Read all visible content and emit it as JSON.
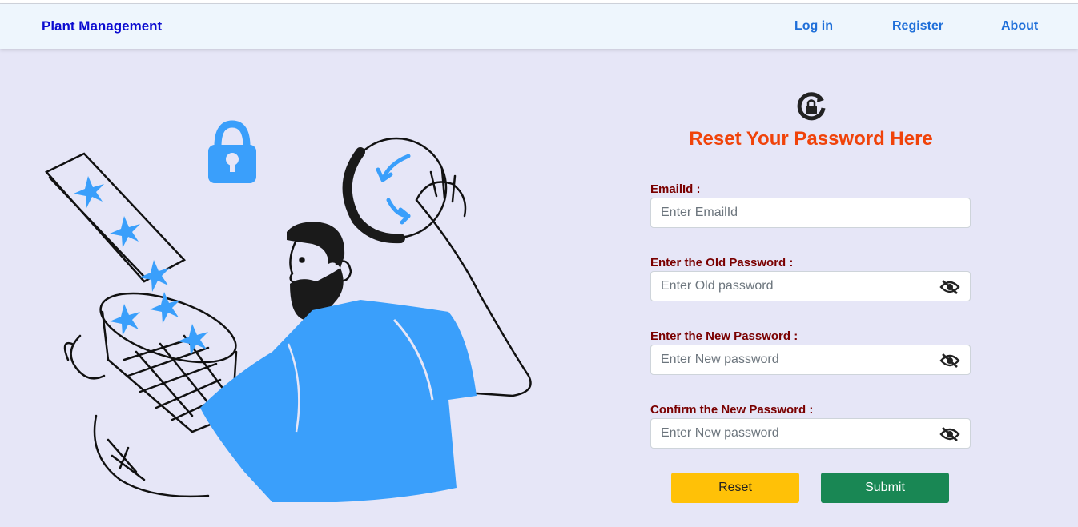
{
  "navbar": {
    "brand": "Plant Management",
    "links": [
      "Log in",
      "Register",
      "About"
    ]
  },
  "form": {
    "icon": "reset-lock-icon",
    "title": "Reset Your Password Here",
    "fields": [
      {
        "label": "EmailId :",
        "placeholder": "Enter EmailId",
        "type": "email",
        "has_eye": false
      },
      {
        "label": "Enter the Old Password :",
        "placeholder": "Enter Old password",
        "type": "password",
        "has_eye": true
      },
      {
        "label": "Enter the New Password :",
        "placeholder": "Enter New password",
        "type": "password",
        "has_eye": true
      },
      {
        "label": "Confirm the New Password :",
        "placeholder": "Enter New password",
        "type": "password",
        "has_eye": true
      }
    ],
    "eye_icon": "eye-slash-icon",
    "buttons": {
      "reset": "Reset",
      "submit": "Submit"
    }
  },
  "colors": {
    "background": "#e6e6f7",
    "navbar": "#eef6fd",
    "brand": "#0b0bd0",
    "nav_link": "#1f6fd9",
    "title": "#f0430a",
    "label": "#7a0000",
    "accent_blue": "#3a9ffb",
    "reset_button": "#ffc107",
    "submit_button": "#198754"
  },
  "illustration": "man-with-basket-and-lock-illustration"
}
